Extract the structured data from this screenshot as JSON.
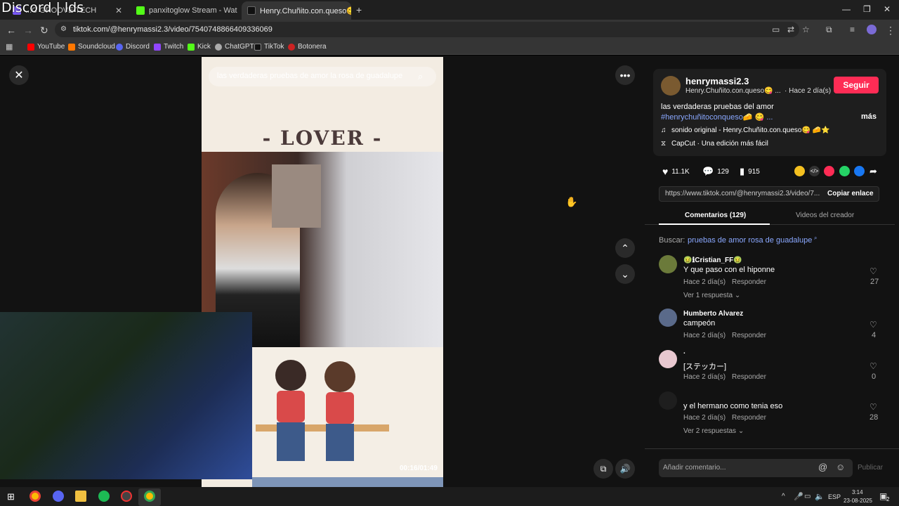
{
  "overlay_title": "Discord | lds",
  "tabs": [
    {
      "label": "...C GROOVE TECH",
      "fav_color": "#7a5af8"
    },
    {
      "label": "panxitoglow Stream - Wat",
      "fav_color": "#53fc18"
    },
    {
      "label": "Henry.Chuñito.con.queso😋",
      "fav_color": "#111111"
    }
  ],
  "new_tab": "+",
  "address_url": "tiktok.com/@henrymassi2.3/video/7540748866409336069",
  "bookmarks": [
    {
      "label": "YouTube",
      "color": "#ff0000"
    },
    {
      "label": "Soundcloud",
      "color": "#ff7700"
    },
    {
      "label": "Discord",
      "color": "#5865f2"
    },
    {
      "label": "Twitch",
      "color": "#9146ff"
    },
    {
      "label": "Kick",
      "color": "#53fc18"
    },
    {
      "label": "ChatGPT",
      "color": "#aaaaaa"
    },
    {
      "label": "TikTok",
      "color": "#111111"
    },
    {
      "label": "Botonera",
      "color": "#cc2222"
    }
  ],
  "video": {
    "search_text": "las verdaderas pruebas de amor la rosa de guadalupe",
    "lover_text": "- LOVER -",
    "timecode": "00:16/01:49"
  },
  "post": {
    "username": "henrymassi2.3",
    "nickname": "Henry.Chuñito.con.queso😋 ...",
    "date": "· Hace 2 día(s)",
    "follow": "Seguir",
    "caption": "las verdaderas pruebas del amor",
    "hashtag": "#henrychuñitoconqueso🧀 😋 ...",
    "more": "más",
    "sound": "sonido original - Henry.Chuñito.con.queso😋 🧀⭐",
    "capcut": "CapCut · Una edición más fácil"
  },
  "stats": {
    "likes": "11.1K",
    "comments": "129",
    "saves": "915"
  },
  "share_link": "https://www.tiktok.com/@henrymassi2.3/video/7...",
  "copy_link": "Copiar enlace",
  "panel_tabs": {
    "comments": "Comentarios (129)",
    "creator": "Videos del creador"
  },
  "search_related": {
    "label": "Buscar:",
    "query": "pruebas de amor rosa de guadalupe"
  },
  "comments": [
    {
      "user": "🤢ℹCristian_FF🤢",
      "text": "Y que paso con el hiponne",
      "date": "Hace 2 día(s)",
      "reply": "Responder",
      "likes": "27",
      "more": "Ver 1 respuesta ⌄",
      "av": "#6b7a3a"
    },
    {
      "user": "Humberto Alvarez",
      "text": "campeón",
      "date": "Hace 2 día(s)",
      "reply": "Responder",
      "likes": "4",
      "more": "",
      "av": "#5a6a8a"
    },
    {
      "user": ".",
      "text": "[ステッカー]",
      "date": "Hace 2 día(s)",
      "reply": "Responder",
      "likes": "0",
      "more": "",
      "av": "#e8c8d0"
    },
    {
      "user": "",
      "text": "y el hermano como tenia eso",
      "date": "Hace 2 día(s)",
      "reply": "Responder",
      "likes": "28",
      "more": "Ver 2 respuestas ⌄",
      "av": "#1e1e1e"
    }
  ],
  "comment_input": {
    "placeholder": "Añadir comentario...",
    "post": "Publicar"
  },
  "taskbar": {
    "lang": "ESP",
    "time": "3:14",
    "date": "23-08-2025",
    "notif": "2"
  }
}
